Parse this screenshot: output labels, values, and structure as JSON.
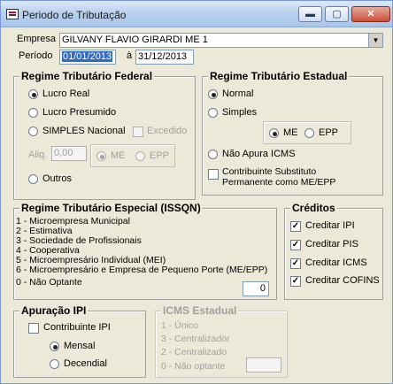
{
  "window": {
    "title": "Periodo de Tributação",
    "min_icon": "minimize-icon",
    "max_icon": "maximize-icon",
    "close_icon": "close-icon"
  },
  "empresa": {
    "label": "Empresa",
    "value": "GILVANY FLAVIO GIRARDI ME   1"
  },
  "periodo": {
    "label": "Período",
    "start": "01/01/2013",
    "sep": "à",
    "end": "31/12/2013"
  },
  "federal": {
    "title": "Regime Tributário Federal",
    "options": [
      "Lucro Real",
      "Lucro Presumido",
      "SIMPLES Nacional",
      "Outros"
    ],
    "selected": "Lucro Real",
    "excedido_label": "Excedido",
    "aliq_label": "Aliq.",
    "aliq_value": "0,00",
    "sub_options": [
      "ME",
      "EPP"
    ],
    "sub_selected": "ME"
  },
  "estadual": {
    "title": "Regime Tributário Estadual",
    "options": [
      "Normal",
      "Simples",
      "Não Apura ICMS"
    ],
    "selected": "Normal",
    "sub_options": [
      "ME",
      "EPP"
    ],
    "sub_selected": "ME",
    "substituto_label_1": "Contribuinte Substituto",
    "substituto_label_2": "Permanente como ME/EPP"
  },
  "especial": {
    "title": "Regime Tributário Especial (ISSQN)",
    "items": [
      "1 - Microempresa Municipal",
      "2 - Estimativa",
      "3 - Sociedade de Profissionais",
      "4 - Cooperativa",
      "5 - Microempresário Individual (MEI)",
      "6 - Microempresário  e Empresa de Pequeno Porte (ME/EPP)",
      "0 - Não Optante"
    ],
    "value": "0"
  },
  "creditos": {
    "title": "Créditos",
    "items": [
      "Creditar IPI",
      "Creditar PIS",
      "Creditar ICMS",
      "Creditar COFINS"
    ],
    "checked": [
      true,
      true,
      true,
      true
    ]
  },
  "ipi": {
    "title": "Apuração IPI",
    "contribuinte_label": "Contribuinte IPI",
    "options": [
      "Mensal",
      "Decendial"
    ],
    "selected": "Mensal"
  },
  "icms_estadual": {
    "title": "ICMS Estadual",
    "items": [
      "1 - Único",
      "3 - Centralizador",
      "2 - Centralizado",
      "0 - Não optante"
    ]
  }
}
